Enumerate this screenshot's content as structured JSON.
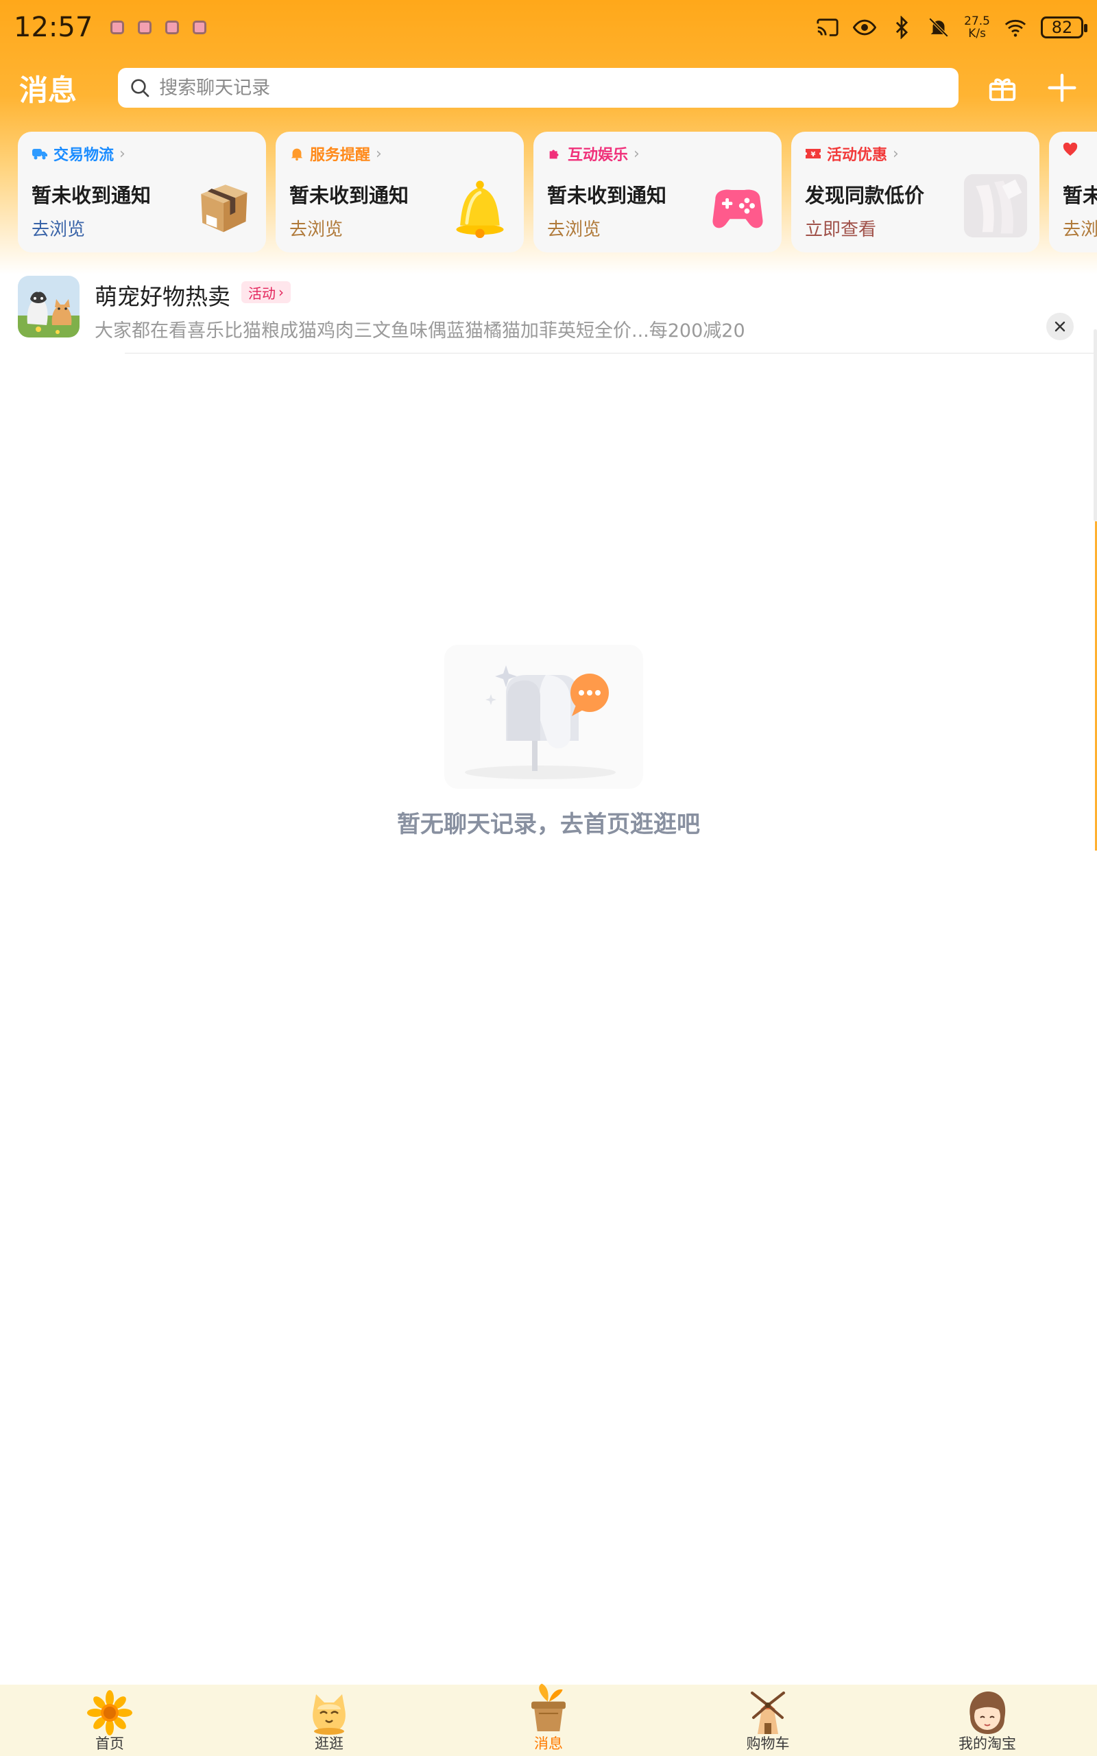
{
  "status_bar": {
    "time": "12:57",
    "net_speed_value": "27.5",
    "net_speed_unit": "K/s",
    "battery": "82"
  },
  "header": {
    "title": "消息",
    "search_placeholder": "搜索聊天记录"
  },
  "cards": [
    {
      "category": "交易物流",
      "title": "暂未收到通知",
      "action": "去浏览",
      "color": "#1a8cff",
      "icon": "truck-icon"
    },
    {
      "category": "服务提醒",
      "title": "暂未收到通知",
      "action": "去浏览",
      "color": "#ff8a1a",
      "icon": "bell-icon"
    },
    {
      "category": "互动娱乐",
      "title": "暂未收到通知",
      "action": "去浏览",
      "color": "#f0307a",
      "icon": "puzzle-icon"
    },
    {
      "category": "活动优惠",
      "title": "发现同款低价",
      "action": "立即查看",
      "color": "#f23a3a",
      "icon": "coupon-icon"
    },
    {
      "category": "",
      "title": "暂未",
      "action": "去浏",
      "color": "#f23a3a",
      "icon": "heart-icon"
    }
  ],
  "promo": {
    "title": "萌宠好物热卖",
    "badge": "活动",
    "description": "大家都在看喜乐比猫粮成猫鸡肉三文鱼味偶蓝猫橘猫加菲英短全价...每200减20"
  },
  "empty_state": {
    "message": "暂无聊天记录，去首页逛逛吧"
  },
  "bottom_nav": [
    {
      "label": "首页",
      "icon": "sunflower-icon"
    },
    {
      "label": "逛逛",
      "icon": "cat-icon"
    },
    {
      "label": "消息",
      "icon": "plant-pot-icon",
      "active": true
    },
    {
      "label": "购物车",
      "icon": "windmill-icon"
    },
    {
      "label": "我的淘宝",
      "icon": "girl-avatar-icon"
    }
  ]
}
